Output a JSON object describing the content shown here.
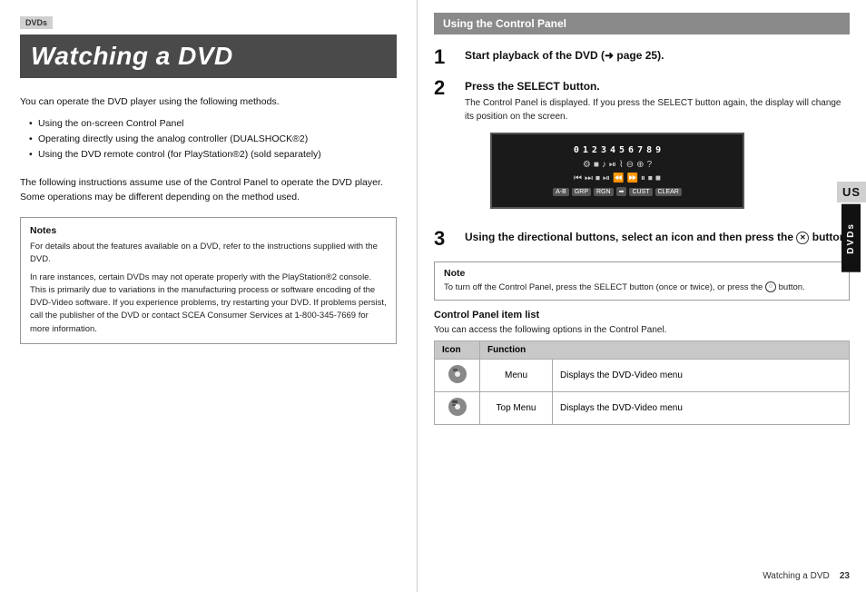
{
  "left": {
    "section_label": "DVDs",
    "page_title": "Watching a DVD",
    "intro_paragraph": "You can operate the DVD player using the following methods.",
    "bullet_items": [
      "Using the on-screen Control Panel",
      "Operating directly using the analog controller (DUALSHOCK®2)",
      "Using the DVD remote control (for PlayStation®2) (sold separately)"
    ],
    "following_text": "The following instructions assume use of the Control Panel to operate the DVD player. Some operations may be different depending on the method used.",
    "notes_title": "Notes",
    "notes": [
      "For details about the features available on a DVD, refer to the instructions supplied with the DVD.",
      "In rare instances, certain DVDs may not operate properly with the PlayStation®2 console. This is primarily due to variations in the manufacturing process or software encoding of the DVD-Video software. If you experience problems, try restarting your DVD. If problems persist, call the publisher of the DVD or contact SCEA Consumer Services at 1-800-345-7669 for more information."
    ]
  },
  "right": {
    "section_header": "Using the Control Panel",
    "steps": [
      {
        "number": "1",
        "title": "Start playback of the DVD (➜ page 25).",
        "body": ""
      },
      {
        "number": "2",
        "title": "Press the SELECT button.",
        "body": "The Control Panel is displayed. If you press the SELECT button again, the display will change its position on the screen."
      },
      {
        "number": "3",
        "title": "Using the directional buttons, select an icon and then press the",
        "title_suffix": "button.",
        "body": ""
      }
    ],
    "note_title": "Note",
    "note_text": "To turn off the Control Panel, press the SELECT button (once or twice), or press the",
    "note_suffix": "button.",
    "control_panel_list_title": "Control Panel item list",
    "control_panel_list_desc": "You can access the following options in the Control Panel.",
    "table_headers": [
      "Icon",
      "Function"
    ],
    "table_rows": [
      {
        "icon_label": "menu-icon",
        "name": "Menu",
        "function": "Displays the DVD-Video menu"
      },
      {
        "icon_label": "top-menu-icon",
        "name": "Top Menu",
        "function": "Displays the DVD-Video menu"
      }
    ],
    "side_tab_us": "US",
    "side_tab_dvds": "DVDs",
    "footer_text": "Watching a DVD",
    "footer_page": "23"
  }
}
